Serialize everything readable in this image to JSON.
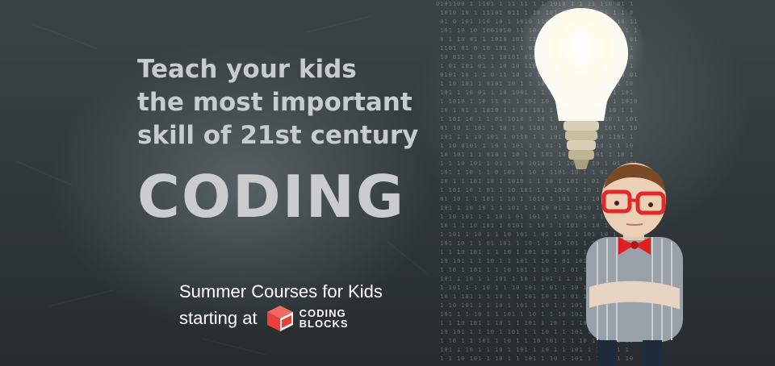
{
  "tagline": {
    "line1": "Teach your kids",
    "line2": "the most important",
    "line3": "skill of 21st century"
  },
  "headline": "CODING",
  "courses": {
    "line1": "Summer Courses for Kids",
    "line2_prefix": "starting at"
  },
  "brand": {
    "name_line1": "CODING",
    "name_line2": "BLOCKS",
    "logo_color": "#e8413c"
  },
  "colors": {
    "background": "#353c3f",
    "tagline_text": "#c7ccce",
    "headline_text": "#c9cdcf",
    "courses_text": "#ffffff"
  },
  "icons": [
    "lightbulb-icon",
    "coding-blocks-logo-icon"
  ]
}
